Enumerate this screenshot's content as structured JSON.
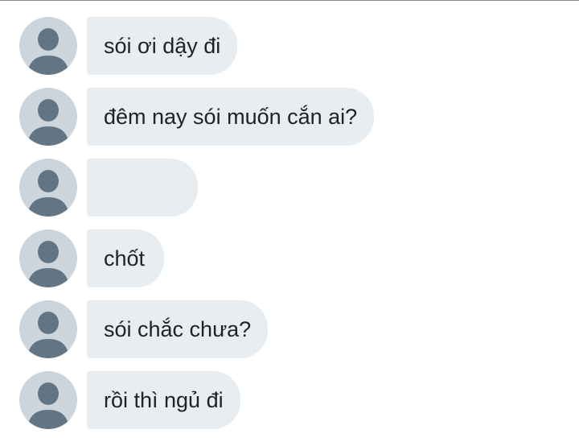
{
  "messages": [
    {
      "text": "sói ơi dậy đi"
    },
    {
      "text": "đêm nay sói muốn cắn ai?"
    },
    {
      "text": ""
    },
    {
      "text": "chốt"
    },
    {
      "text": "sói chắc chưa?"
    },
    {
      "text": "rồi thì ngủ đi"
    }
  ],
  "colors": {
    "bubble": "#e8edf1",
    "avatar_bg": "#ccd5dc",
    "avatar_fg": "#627585",
    "text": "#222222"
  },
  "icons": {
    "avatar": "default-user-avatar-icon"
  }
}
